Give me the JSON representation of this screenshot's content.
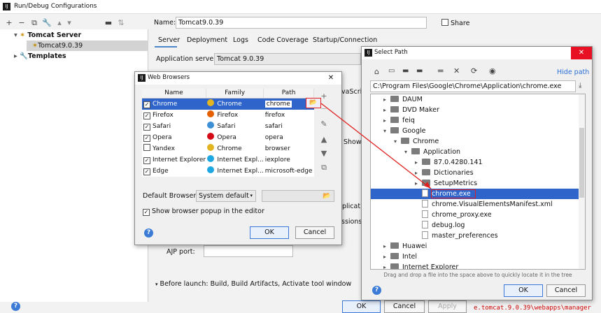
{
  "main_window": {
    "title": "Run/Debug Configurations",
    "toolbar_icons": [
      "add-icon",
      "remove-icon",
      "copy-icon",
      "wrench-icon",
      "folder-icon",
      "sort-icon"
    ],
    "tree": {
      "tomcat_server": "Tomcat Server",
      "tomcat_instance": "Tomcat9.0.39",
      "templates": "Templates"
    },
    "name_label": "Name:",
    "name_value": "Tomcat9.0.39",
    "share_label": "Share",
    "tabs": [
      "Server",
      "Deployment",
      "Logs",
      "Code Coverage",
      "Startup/Connection"
    ],
    "app_server_label": "Application server:",
    "app_server_value": "Tomcat 9.0.39",
    "ajp_label": "AJP port:",
    "before_launch": "Before launch: Build, Build Artifacts, Activate tool window",
    "partial_text": {
      "javascript": "vaScri",
      "show": "Show",
      "application": "plication",
      "sessions": "ssions a"
    },
    "buttons": {
      "ok": "OK",
      "cancel": "Cancel",
      "apply": "Apply"
    },
    "bottom_log": "e.tomcat.9.0.39\\webapps\\manager"
  },
  "web_browsers": {
    "title": "Web Browsers",
    "columns": [
      "Name",
      "Family",
      "Path"
    ],
    "rows": [
      {
        "checked": true,
        "name": "Chrome",
        "family": "Chrome",
        "path": "chrome",
        "color": "#e2b41f"
      },
      {
        "checked": true,
        "name": "Firefox",
        "family": "Firefox",
        "path": "firefox",
        "color": "#e66000"
      },
      {
        "checked": true,
        "name": "Safari",
        "family": "Safari",
        "path": "safari",
        "color": "#3d8fd6"
      },
      {
        "checked": true,
        "name": "Opera",
        "family": "Opera",
        "path": "opera",
        "color": "#d40a16"
      },
      {
        "checked": false,
        "name": "Yandex",
        "family": "Chrome",
        "path": "browser",
        "color": "#e2b41f"
      },
      {
        "checked": true,
        "name": "Internet Explorer",
        "family": "Internet Expl...",
        "path": "iexplore",
        "color": "#1ea7e1"
      },
      {
        "checked": true,
        "name": "Edge",
        "family": "Internet Expl...",
        "path": "microsoft-edge",
        "color": "#1ea7e1"
      }
    ],
    "default_browser_label": "Default Browser:",
    "default_browser_value": "System default",
    "popup_label": "Show browser popup in the editor",
    "buttons": {
      "ok": "OK",
      "cancel": "Cancel"
    }
  },
  "select_path": {
    "title": "Select Path",
    "hide_path": "Hide path",
    "path_value": "C:\\Program Files\\Google\\Chrome\\Application\\chrome.exe",
    "tree": [
      {
        "label": "DAUM",
        "kind": "folder",
        "depth": 0,
        "expander": "right"
      },
      {
        "label": "DVD Maker",
        "kind": "folder",
        "depth": 0,
        "expander": "right"
      },
      {
        "label": "feiq",
        "kind": "folder",
        "depth": 0,
        "expander": "right"
      },
      {
        "label": "Google",
        "kind": "folder",
        "depth": 0,
        "expander": "down"
      },
      {
        "label": "Chrome",
        "kind": "folder",
        "depth": 1,
        "expander": "down"
      },
      {
        "label": "Application",
        "kind": "folder",
        "depth": 2,
        "expander": "down"
      },
      {
        "label": "87.0.4280.141",
        "kind": "folder",
        "depth": 3,
        "expander": "right"
      },
      {
        "label": "Dictionaries",
        "kind": "folder",
        "depth": 3,
        "expander": "right"
      },
      {
        "label": "SetupMetrics",
        "kind": "folder",
        "depth": 3,
        "expander": "right"
      },
      {
        "label": "chrome.exe",
        "kind": "file",
        "depth": 3,
        "expander": "",
        "selected": true
      },
      {
        "label": "chrome.VisualElementsManifest.xml",
        "kind": "file",
        "depth": 3,
        "expander": ""
      },
      {
        "label": "chrome_proxy.exe",
        "kind": "file",
        "depth": 3,
        "expander": ""
      },
      {
        "label": "debug.log",
        "kind": "file",
        "depth": 3,
        "expander": ""
      },
      {
        "label": "master_preferences",
        "kind": "file",
        "depth": 3,
        "expander": ""
      },
      {
        "label": "Huawei",
        "kind": "folder",
        "depth": 0,
        "expander": "right"
      },
      {
        "label": "Intel",
        "kind": "folder",
        "depth": 0,
        "expander": "right"
      },
      {
        "label": "Internet Explorer",
        "kind": "folder",
        "depth": 0,
        "expander": "right"
      }
    ],
    "hint": "Drag and drop a file into the space above to quickly locate it in the tree",
    "buttons": {
      "ok": "OK",
      "cancel": "Cancel"
    }
  },
  "colors": {
    "selection": "#2f65ca",
    "accent": "#3c78d8",
    "annotation_red": "#e02020"
  }
}
